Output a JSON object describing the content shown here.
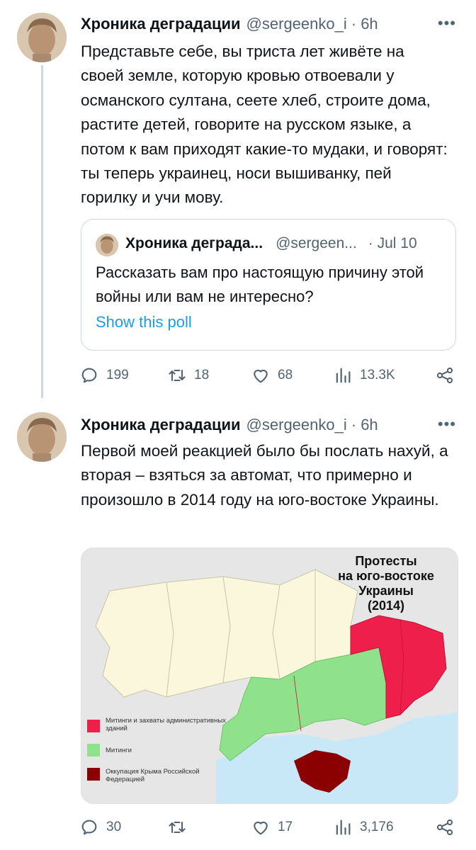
{
  "tweets": [
    {
      "author_name": "Хроника деградации",
      "handle": "@sergeenko_i",
      "time": "· 6h",
      "text": "Представьте себе, вы триста лет живёте на своей земле, которую кровью отвоевали у османского султана, сеете хлеб, строите дома, растите детей, говорите на русском языке, а потом к вам приходят какие-то мудаки, и говорят: ты теперь украинец, носи вышиванку, пей горилку и учи мову.",
      "quote": {
        "author_name": "Хроника деграда...",
        "handle": "@sergeen...",
        "time": "· Jul 10",
        "text": "Рассказать вам про настоящую причину этой войны или вам не интересно?",
        "link": "Show this poll"
      },
      "actions": {
        "replies": "199",
        "retweets": "18",
        "likes": "68",
        "views": "13.3K"
      }
    },
    {
      "author_name": "Хроника деградации",
      "handle": "@sergeenko_i",
      "time": "· 6h",
      "text": "Первой моей реакцией было бы послать нахуй, а вторая – взяться за автомат, что примерно и произошло в 2014 году на юго-востоке Украины.",
      "map": {
        "title_lines": [
          "Протесты",
          "на юго-востоке",
          "Украины",
          "(2014)"
        ],
        "legend": [
          {
            "label": "Митинги и захваты административных зданий",
            "color": "#ee1f4a"
          },
          {
            "label": "Митинги",
            "color": "#8fe28b"
          },
          {
            "label": "Оккупация Крыма Российской Федерацией",
            "color": "#8b0000"
          }
        ],
        "colors": {
          "sea": "#c9e8f7",
          "neutral": "#faf7dc",
          "background": "#e6e6e6"
        }
      },
      "actions": {
        "replies": "30",
        "retweets": "",
        "likes": "17",
        "views": "3,176"
      }
    }
  ],
  "icons": [
    "reply-icon",
    "retweet-icon",
    "like-icon",
    "views-icon",
    "share-icon",
    "more-icon"
  ],
  "colors": {
    "accent": "#1d9bf0",
    "secondary_text": "#536471",
    "border": "#cfd9de"
  }
}
